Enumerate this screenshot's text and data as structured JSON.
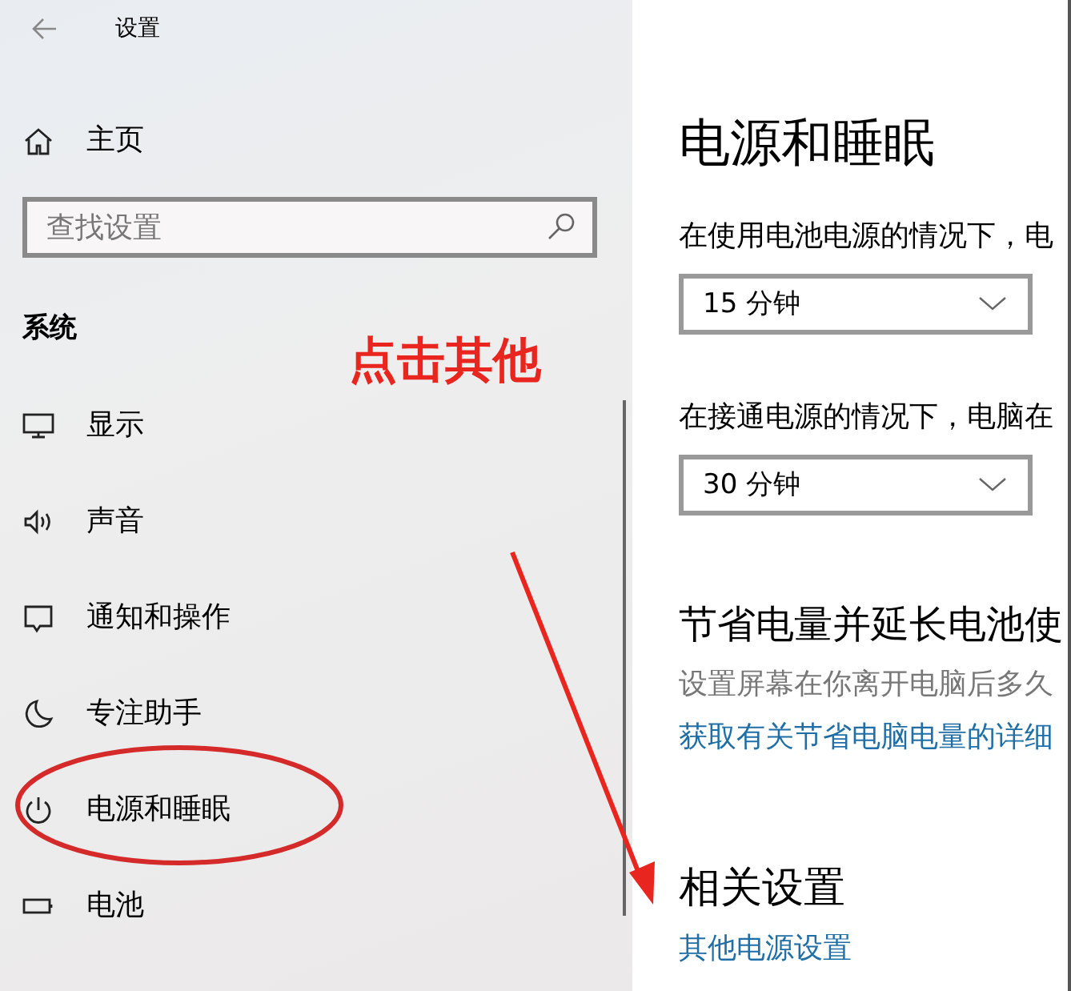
{
  "window": {
    "title": "设置"
  },
  "sidebar": {
    "home": "主页",
    "search": {
      "placeholder": "查找设置"
    },
    "section": "系统",
    "items": [
      {
        "kind": "display",
        "label": "显示"
      },
      {
        "kind": "sound",
        "label": "声音"
      },
      {
        "kind": "notification",
        "label": "通知和操作"
      },
      {
        "kind": "focus",
        "label": "专注助手"
      },
      {
        "kind": "power",
        "label": "电源和睡眠"
      },
      {
        "kind": "battery",
        "label": "电池"
      }
    ]
  },
  "main": {
    "title": "电源和睡眠",
    "dropdowns": [
      {
        "label": "在使用电池电源的情况下，电",
        "value": "15 分钟"
      },
      {
        "label": "在接通电源的情况下，电脑在",
        "value": "30 分钟"
      }
    ],
    "save_section": {
      "heading": "节省电量并延长电池使",
      "description": "设置屏幕在你离开电脑后多久",
      "link": "获取有关节省电脑电量的详细"
    },
    "related": {
      "heading": "相关设置",
      "link": "其他电源设置"
    }
  },
  "annotation": {
    "text": "点击其他"
  }
}
